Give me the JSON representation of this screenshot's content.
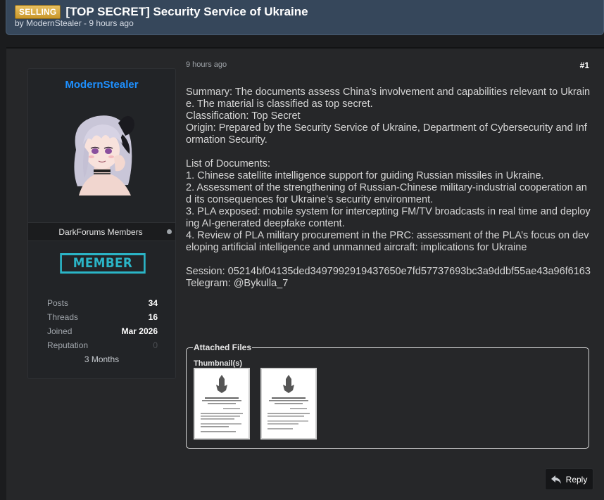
{
  "thread": {
    "prefix": "SELLING",
    "title": "[TOP SECRET] Security Service of Ukraine",
    "byline": "by ModernStealer - 9 hours ago"
  },
  "user": {
    "username": "ModernStealer",
    "avatar_icon": "anime-avatar",
    "group": "DarkForums Members",
    "rank": "MEMBER",
    "stats": [
      {
        "label": "Posts",
        "value": "34"
      },
      {
        "label": "Threads",
        "value": "16"
      },
      {
        "label": "Joined",
        "value": "Mar 2026"
      },
      {
        "label": "Reputation",
        "value": "0"
      }
    ],
    "tenure": "3 Months"
  },
  "post": {
    "date": "9 hours ago",
    "number": "#1",
    "lines": [
      "Summary: The documents assess China’s involvement and capabilities relevant to Ukraine. The material is classified as top secret.",
      "Classification: Top Secret",
      "Origin: Prepared by the Security Service of Ukraine, Department of Cybersecurity and Information Security.",
      "",
      "List of Documents:",
      "1. Chinese satellite intelligence support for guiding Russian missiles in Ukraine.",
      "2. Assessment of the strengthening of Russian-Chinese military-industrial cooperation and its consequences for Ukraine’s security environment.",
      "3. PLA exposed: mobile system for intercepting FM/TV broadcasts in real time and deploying AI-generated deepfake content.",
      "4. Review of PLA military procurement in the PRC: assessment of the PLA’s focus on developing artificial intelligence and unmanned aircraft: implications for Ukraine",
      "",
      "Session: 05214bf04135ded3497992919437650e7fd57737693bc3a9ddbf55ae43a96f6163",
      "Telegram: @Bykulla_7"
    ]
  },
  "attachments": {
    "legend": "Attached Files",
    "thumbnails_label": "Thumbnail(s)",
    "thumbnails": [
      {
        "icon": "document-thumbnail"
      },
      {
        "icon": "document-thumbnail"
      }
    ]
  },
  "actions": {
    "reply_label": "Reply",
    "reply_icon": "reply-arrow-icon"
  },
  "colors": {
    "header_bg": "#36475b",
    "username": "#1e90ff",
    "rank": "#2bb5c7",
    "prefix_badge": "#d9a93c"
  }
}
